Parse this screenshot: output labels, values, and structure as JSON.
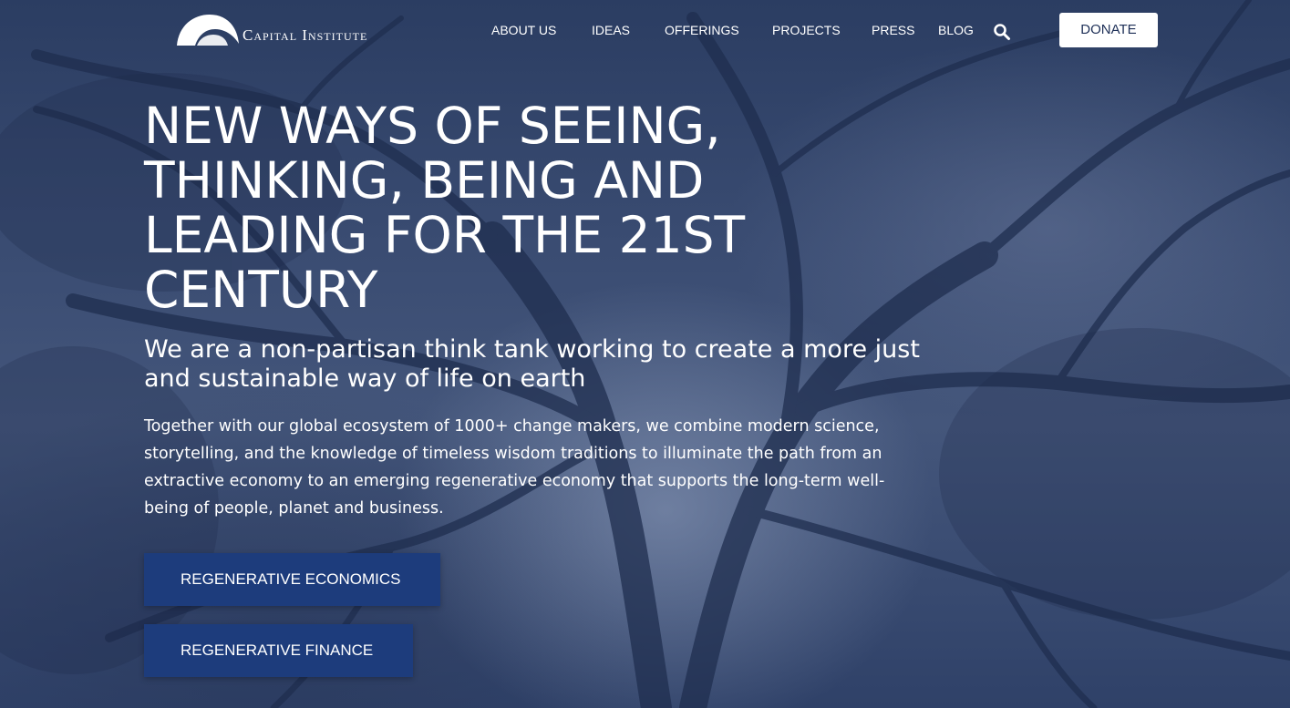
{
  "brand": {
    "name": "Capital Institute",
    "logo_icon": "crescent-arc-logo-icon"
  },
  "nav": {
    "items": [
      {
        "label": "ABOUT US"
      },
      {
        "label": "IDEAS"
      },
      {
        "label": "OFFERINGS"
      },
      {
        "label": "PROJECTS"
      },
      {
        "label": "PRESS"
      },
      {
        "label": "BLOG"
      }
    ],
    "search_icon": "search-icon",
    "donate_label": "DONATE"
  },
  "hero": {
    "headline": "NEW WAYS OF SEEING, THINKING, BEING AND LEADING FOR THE 21ST CENTURY",
    "subheadline": "We are a non-partisan think tank working to create a more just and sustainable way of life on earth",
    "body": "Together with our global ecosystem of 1000+ change makers, we combine modern science, storytelling, and the knowledge of timeless wisdom traditions to illuminate the path from an extractive economy to an emerging regenerative economy that supports the long-term well-being of people, planet and business.",
    "buttons": [
      {
        "label": "REGENERATIVE ECONOMICS"
      },
      {
        "label": "REGENERATIVE FINANCE"
      }
    ]
  },
  "colors": {
    "background_overlay": "#34466c",
    "button_primary": "#1d3c7c",
    "donate_bg": "#ffffff",
    "donate_text": "#1d2f57"
  }
}
